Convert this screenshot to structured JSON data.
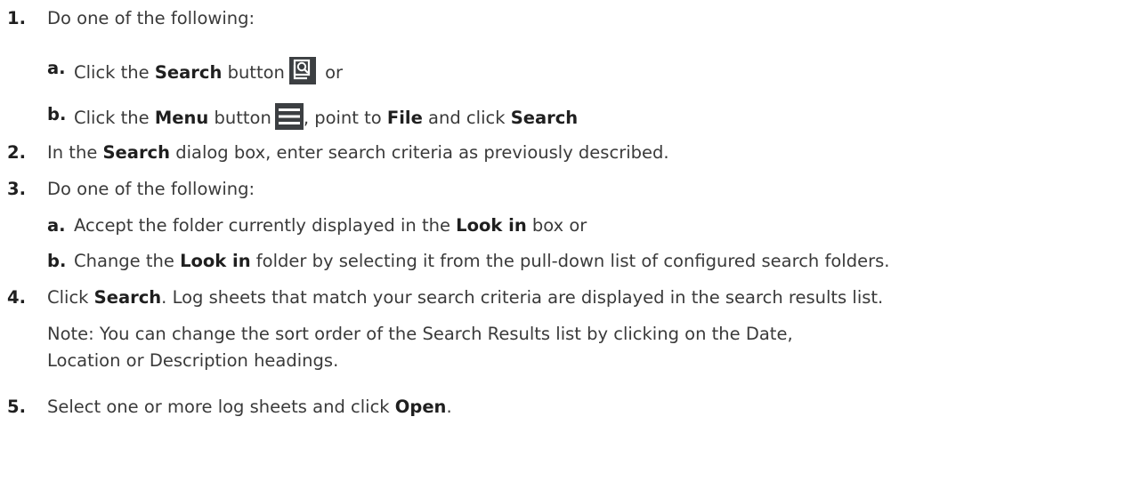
{
  "steps": [
    {
      "num": "1.",
      "text": "Do one of the following:"
    },
    {
      "num": "2.",
      "pre": "In the ",
      "bold": "Search",
      "post": " dialog box, enter search criteria as previously described."
    },
    {
      "num": "3.",
      "text": "Do one of the following:"
    },
    {
      "num": "4.",
      "pre": "Click ",
      "bold": "Search",
      "post": ".  Log sheets that match your search criteria are displayed in the search results list."
    },
    {
      "num": "5.",
      "pre": "Select one or more log sheets and click ",
      "bold": "Open",
      "post": "."
    }
  ],
  "step1": {
    "a": {
      "letter": "a.",
      "pre": "Click the ",
      "bold": "Search",
      "mid": " button",
      "post": " or",
      "icon": "search-icon"
    },
    "b": {
      "letter": "b.",
      "pre": "Click the ",
      "bold": "Menu",
      "mid": " button",
      "mid2": ", point to ",
      "bold2": "File",
      "mid3": " and click ",
      "bold3": "Search",
      "icon": "menu-icon"
    }
  },
  "step3": {
    "a": {
      "letter": "a.",
      "pre": "Accept the folder currently displayed in the ",
      "bold": "Look in",
      "post": " box or"
    },
    "b": {
      "letter": "b.",
      "pre": "Change the ",
      "bold": "Look in",
      "post": " folder by selecting it from the pull-down list of configured search folders."
    }
  },
  "note": {
    "line1": "Note:  You can change the sort order of the Search Results list by clicking on the Date,",
    "line2": "Location or Description headings."
  }
}
